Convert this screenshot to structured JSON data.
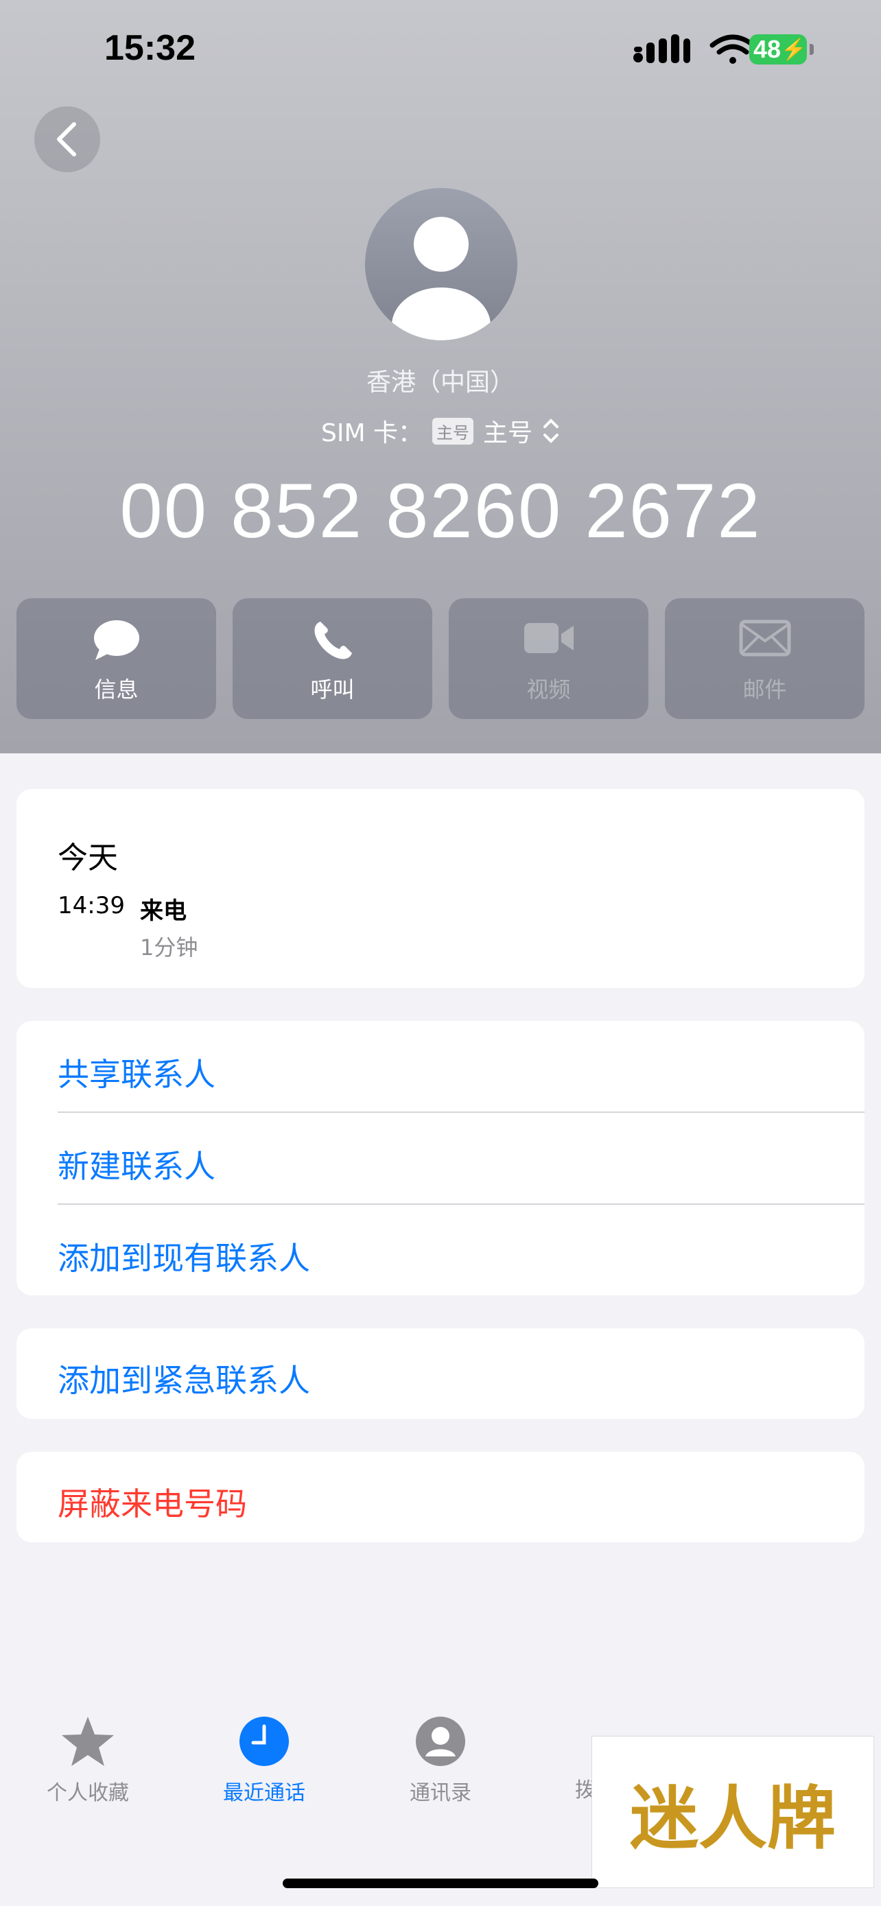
{
  "status_bar": {
    "time": "15:32",
    "battery": "48"
  },
  "contact": {
    "location": "香港（中国）",
    "sim_label": "SIM 卡：",
    "sim_badge": "主号",
    "sim_value": "主号",
    "number": "00 852 8260 2672"
  },
  "actions": [
    {
      "label": "信息",
      "icon": "message-icon",
      "enabled": true
    },
    {
      "label": "呼叫",
      "icon": "phone-icon",
      "enabled": true
    },
    {
      "label": "视频",
      "icon": "video-icon",
      "enabled": false
    },
    {
      "label": "邮件",
      "icon": "mail-icon",
      "enabled": false
    }
  ],
  "recent": {
    "title": "今天",
    "time": "14:39",
    "type": "来电",
    "duration": "1分钟"
  },
  "menu": {
    "share": "共享联系人",
    "new": "新建联系人",
    "add_existing": "添加到现有联系人",
    "add_emergency": "添加到紧急联系人",
    "block": "屏蔽来电号码"
  },
  "tabs": [
    {
      "label": "个人收藏",
      "icon": "star-icon"
    },
    {
      "label": "最近通话",
      "icon": "clock-icon",
      "active": true
    },
    {
      "label": "通讯录",
      "icon": "person-icon"
    },
    {
      "label": "拨",
      "icon": "keypad-icon"
    }
  ],
  "watermark": "迷人牌",
  "colors": {
    "accent": "#0a7aff",
    "danger": "#ff3b30",
    "battery": "#34c759"
  }
}
